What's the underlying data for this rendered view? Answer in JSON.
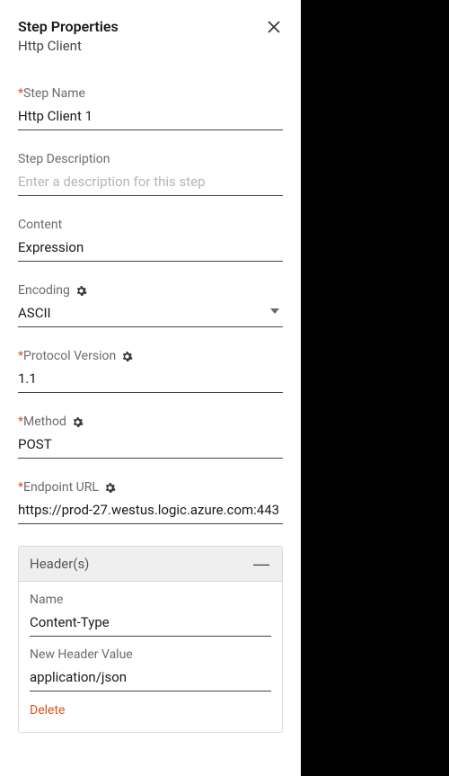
{
  "header": {
    "title": "Step Properties",
    "subtitle": "Http Client"
  },
  "fields": {
    "stepName": {
      "label": "Step Name",
      "value": "Http Client 1"
    },
    "stepDesc": {
      "label": "Step Description",
      "placeholder": "Enter a description for this step",
      "value": ""
    },
    "content": {
      "label": "Content",
      "value": "Expression"
    },
    "encoding": {
      "label": "Encoding",
      "value": "ASCII"
    },
    "protocol": {
      "label": "Protocol Version",
      "value": "1.1"
    },
    "method": {
      "label": "Method",
      "value": "POST"
    },
    "endpoint": {
      "label": "Endpoint URL",
      "value": "https://prod-27.westus.logic.azure.com:443"
    }
  },
  "headersSection": {
    "title": "Header(s)",
    "nameLabel": "Name",
    "nameValue": "Content-Type",
    "valueLabel": "New Header Value",
    "valueValue": "application/json",
    "deleteLabel": "Delete"
  },
  "requiredMark": "*",
  "collapseGlyph": "—"
}
